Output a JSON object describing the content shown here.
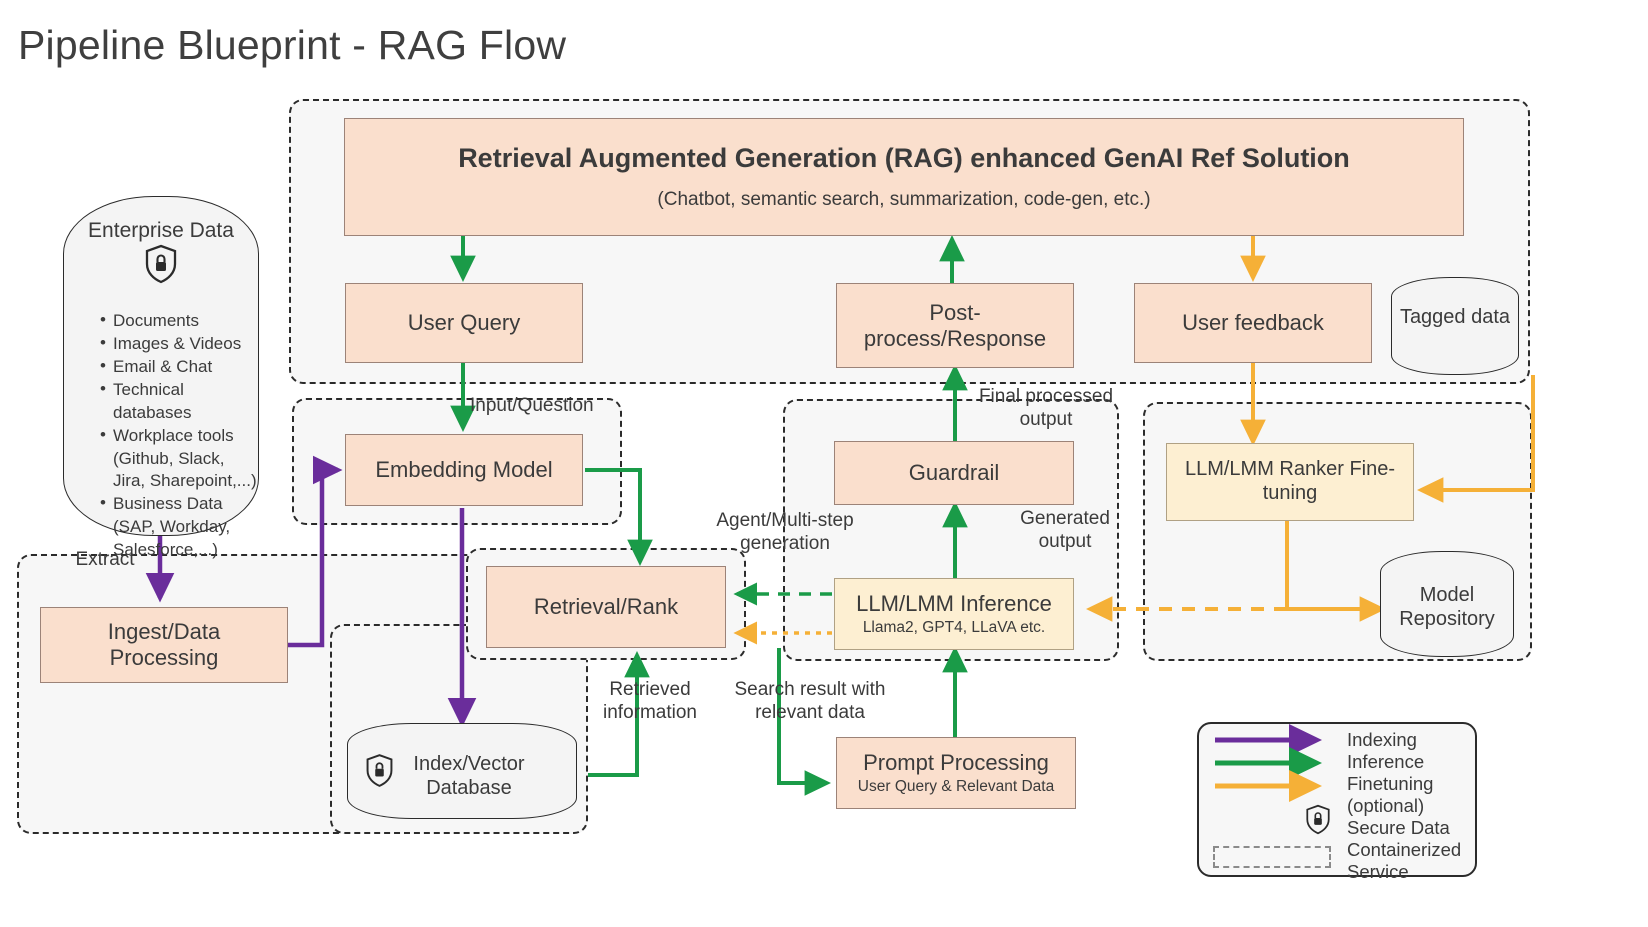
{
  "page": {
    "title": "Pipeline Blueprint - RAG Flow"
  },
  "colors": {
    "process_fill": "#fadfcd",
    "model_fill": "#fdefd2",
    "indexing": "#6a2d9b",
    "inference": "#1a9b48",
    "finetuning": "#f5b037",
    "group_fill": "#f7f7f7"
  },
  "enterprise_data": {
    "label": "Enterprise Data",
    "icon": "shield-lock-icon",
    "bullets": [
      "Documents",
      "Images & Videos",
      "Email & Chat",
      "Technical databases",
      "Workplace tools (Github, Slack, Jira, Sharepoint,...)",
      "Business Data (SAP, Workday, Salesforce,...)"
    ]
  },
  "nodes": {
    "rag_solution": {
      "title": "Retrieval Augmented Generation (RAG) enhanced GenAI Ref Solution",
      "subtitle": "(Chatbot, semantic search, summarization, code-gen, etc.)"
    },
    "user_query": {
      "label": "User Query"
    },
    "post_process": {
      "label": "Post-process/Response"
    },
    "user_feedback": {
      "label": "User feedback"
    },
    "tagged_data": {
      "label": "Tagged data"
    },
    "embedding_model": {
      "label": "Embedding Model"
    },
    "retrieval_rank": {
      "label": "Retrieval/Rank"
    },
    "guardrail": {
      "label": "Guardrail"
    },
    "llm_inference": {
      "label": "LLM/LMM Inference",
      "sublabel": "Llama2, GPT4, LLaVA etc."
    },
    "ranker_finetune": {
      "label": "LLM/LMM Ranker Fine-tuning"
    },
    "model_repository": {
      "label": "Model Repository"
    },
    "ingest": {
      "label": "Ingest/Data Processing"
    },
    "index_vector_db": {
      "label": "Index/Vector Database",
      "icon": "shield-lock-icon"
    },
    "prompt_processing": {
      "label": "Prompt Processing",
      "sublabel": "User Query & Relevant Data"
    }
  },
  "edge_labels": {
    "extract": "Extract",
    "input_question": "Input/Question",
    "final_processed_output": "Final processed output",
    "agent_multistep": "Agent/Multi-step generation",
    "generated_output": "Generated output",
    "retrieved_information": "Retrieved information",
    "search_result": "Search result with relevant data"
  },
  "legend": {
    "items": [
      {
        "kind": "arrow",
        "color": "#6a2d9b",
        "label": "Indexing"
      },
      {
        "kind": "arrow",
        "color": "#1a9b48",
        "label": "Inference"
      },
      {
        "kind": "arrow",
        "color": "#f5b037",
        "label": "Finetuning (optional)"
      },
      {
        "kind": "shield",
        "label": "Secure Data"
      },
      {
        "kind": "dashbox",
        "label": "Containerized Service"
      }
    ],
    "labels": [
      "Indexing",
      "Inference",
      "Finetuning",
      "(optional)",
      "Secure Data",
      "Containerized",
      "Service"
    ]
  }
}
